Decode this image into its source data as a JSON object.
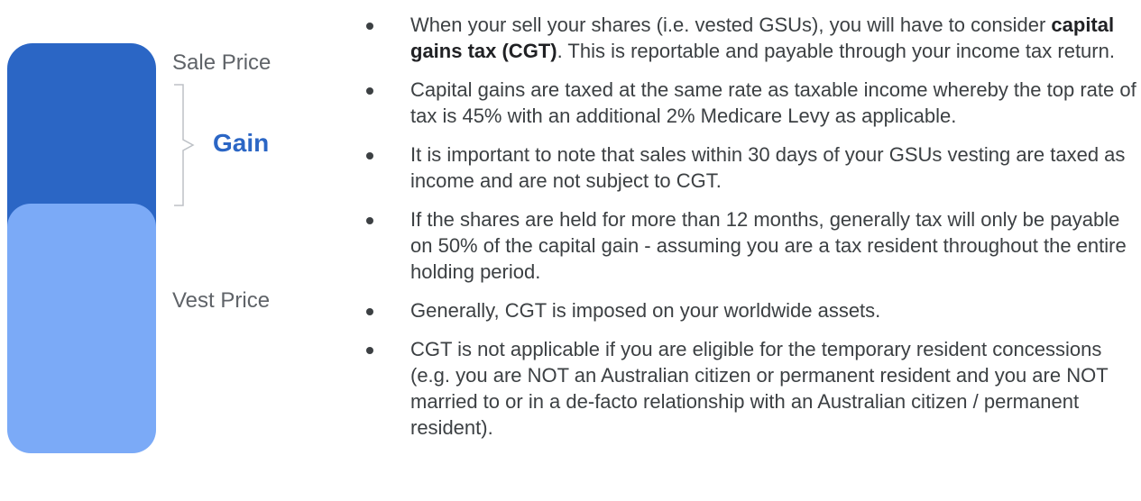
{
  "colors": {
    "bar_dark": "#2b66c5",
    "bar_light": "#7baaf7",
    "gain_text": "#2b66c5"
  },
  "diagram": {
    "sale_label": "Sale Price",
    "gain_label": "Gain",
    "vest_label": "Vest Price"
  },
  "bullets": [
    {
      "pre": "When your sell your shares (i.e. vested GSUs), you will have to consider ",
      "bold": "capital gains tax (CGT)",
      "post": ". This is reportable and payable through your income tax return."
    },
    {
      "pre": "Capital gains are taxed at the same rate as taxable income whereby the top rate of tax is 45% with an additional 2% Medicare Levy as applicable.",
      "bold": "",
      "post": ""
    },
    {
      "pre": "It is important to note that sales within 30 days of your GSUs vesting are taxed as income and are not subject to CGT.",
      "bold": "",
      "post": ""
    },
    {
      "pre": "If the shares are held for more than 12 months, generally tax will only be payable on 50% of the capital gain - assuming you are a tax resident throughout the entire holding period.",
      "bold": "",
      "post": ""
    },
    {
      "pre": "Generally, CGT is imposed on your worldwide assets.",
      "bold": "",
      "post": ""
    },
    {
      "pre": "CGT is not applicable if you are eligible for the temporary resident concessions (e.g. you are NOT an Australian citizen or permanent resident and you are NOT married to or in a de-facto relationship with an Australian citizen / permanent resident).",
      "bold": "",
      "post": ""
    }
  ]
}
